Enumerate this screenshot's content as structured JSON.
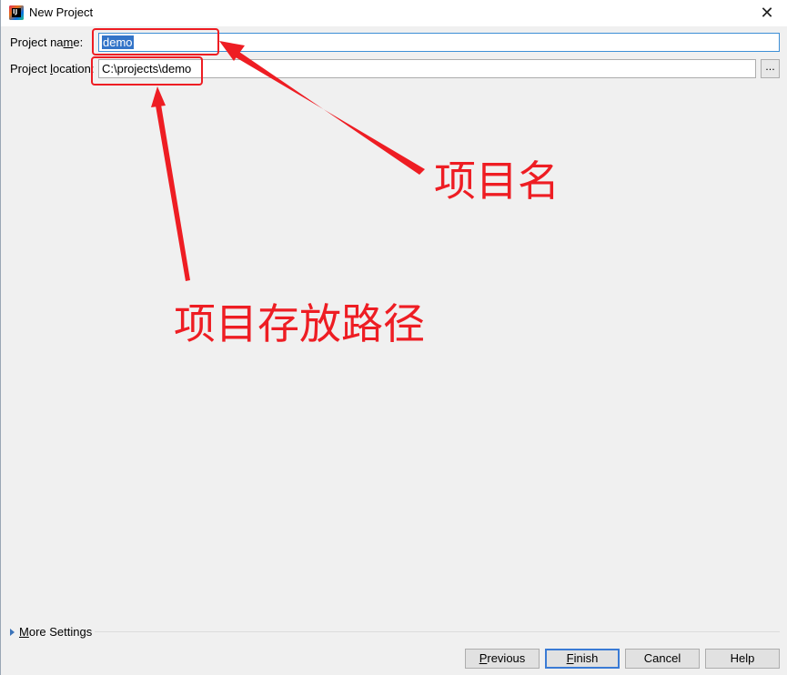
{
  "window": {
    "title": "New Project",
    "app_icon_text": "IJ",
    "close_glyph": "✕"
  },
  "form": {
    "name_label": "Project na",
    "name_label_u": "m",
    "name_label_rest": "e:",
    "name_value": "demo",
    "location_label": "Project ",
    "location_label_u": "l",
    "location_label_rest": "ocation:",
    "location_value": "C:\\projects\\demo",
    "browse_label": "..."
  },
  "more_settings": {
    "label_u": "M",
    "label_rest": "ore Settings"
  },
  "buttons": {
    "previous_u": "P",
    "previous_rest": "revious",
    "finish_u": "F",
    "finish_rest": "inish",
    "cancel": "Cancel",
    "help": "Help"
  },
  "annotations": {
    "name_text": "项目名",
    "location_text": "项目存放路径",
    "color": "#ee1d23"
  }
}
